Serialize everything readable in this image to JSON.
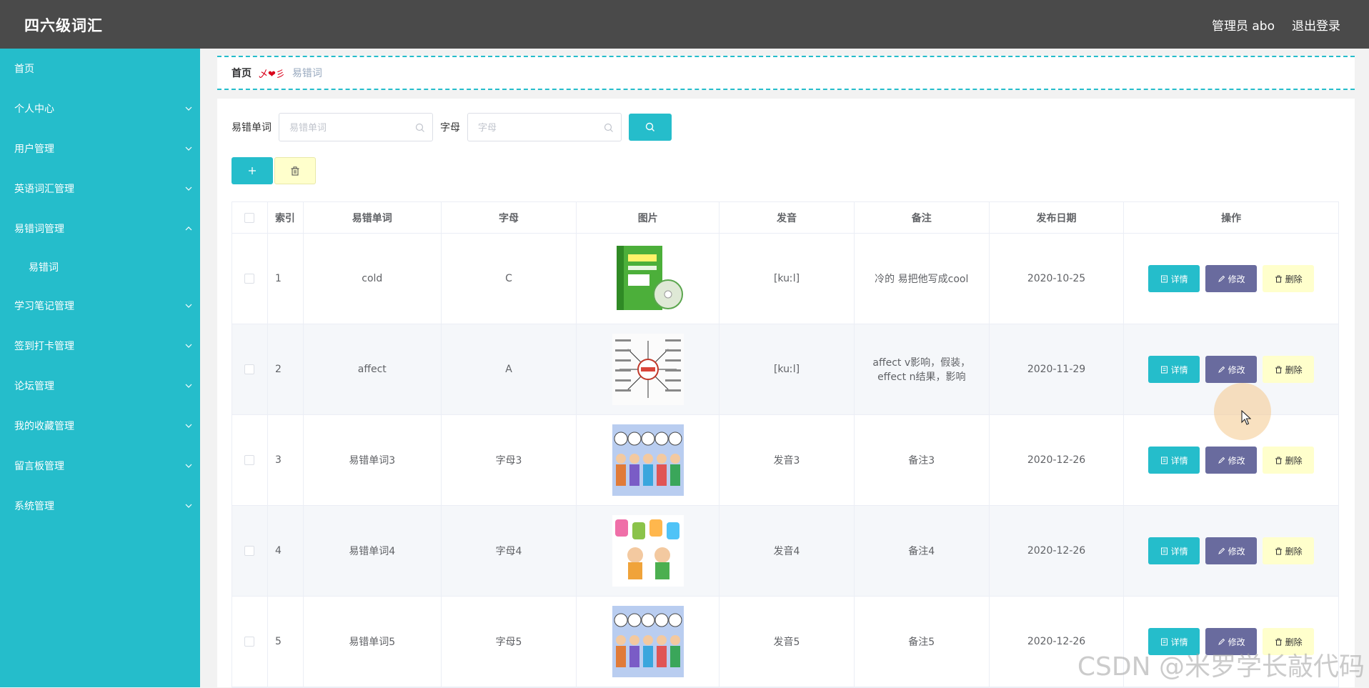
{
  "header": {
    "title": "四六级词汇",
    "user_label": "管理员 abo",
    "logout_label": "退出登录"
  },
  "sidebar": {
    "items": [
      {
        "label": "首页",
        "has_children": false
      },
      {
        "label": "个人中心",
        "has_children": true,
        "expanded": false
      },
      {
        "label": "用户管理",
        "has_children": true,
        "expanded": false
      },
      {
        "label": "英语词汇管理",
        "has_children": true,
        "expanded": false
      },
      {
        "label": "易错词管理",
        "has_children": true,
        "expanded": true
      },
      {
        "label": "易错词",
        "has_children": false,
        "sub": true
      },
      {
        "label": "学习笔记管理",
        "has_children": true,
        "expanded": false
      },
      {
        "label": "签到打卡管理",
        "has_children": true,
        "expanded": false
      },
      {
        "label": "论坛管理",
        "has_children": true,
        "expanded": false
      },
      {
        "label": "我的收藏管理",
        "has_children": true,
        "expanded": false
      },
      {
        "label": "留言板管理",
        "has_children": true,
        "expanded": false
      },
      {
        "label": "系统管理",
        "has_children": true,
        "expanded": false
      }
    ]
  },
  "breadcrumb": {
    "home": "首页",
    "separator": "乄❤彡",
    "current": "易错词"
  },
  "search": {
    "word_label": "易错单词",
    "word_placeholder": "易错单词",
    "letter_label": "字母",
    "letter_placeholder": "字母"
  },
  "table": {
    "headers": [
      "",
      "索引",
      "易错单词",
      "字母",
      "图片",
      "发音",
      "备注",
      "发布日期",
      "操作"
    ],
    "rows": [
      {
        "index": "1",
        "word": "cold",
        "letter": "C",
        "image": "book-cover",
        "sound": "[kuːl]",
        "note": "冷的 易把他写成cool",
        "date": "2020-10-25"
      },
      {
        "index": "2",
        "word": "affect",
        "letter": "A",
        "image": "have-mindmap",
        "sound": "[kuːl]",
        "note": "affect v影响，假装，effect n结果，影响",
        "date": "2020-11-29"
      },
      {
        "index": "3",
        "word": "易错单词3",
        "letter": "字母3",
        "image": "hello-kids",
        "sound": "发音3",
        "note": "备注3",
        "date": "2020-12-26"
      },
      {
        "index": "4",
        "word": "易错单词4",
        "letter": "字母4",
        "image": "abcd-kids",
        "sound": "发音4",
        "note": "备注4",
        "date": "2020-12-26"
      },
      {
        "index": "5",
        "word": "易错单词5",
        "letter": "字母5",
        "image": "hello-kids",
        "sound": "发音5",
        "note": "备注5",
        "date": "2020-12-26"
      }
    ],
    "actions": {
      "detail": "详情",
      "edit": "修改",
      "delete": "删除"
    }
  },
  "watermark": "CSDN @米罗学长敲代码",
  "colors": {
    "accent": "#25bdcb",
    "edit": "#696b9e",
    "delete": "#ffffcc",
    "topbar": "#4a4a4a"
  }
}
